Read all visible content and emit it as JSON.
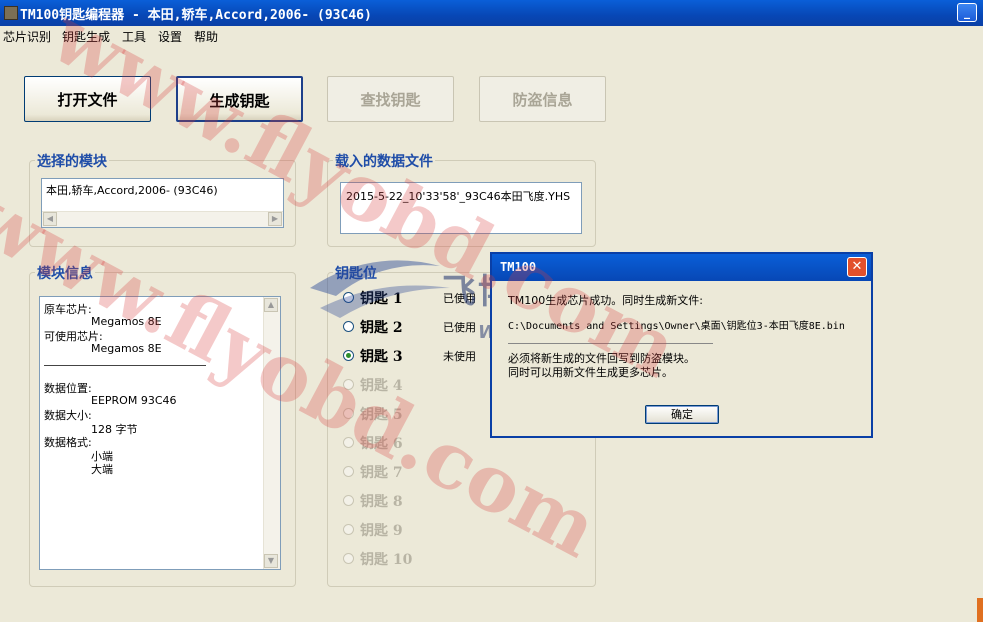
{
  "window": {
    "title": "TM100钥匙编程器 - 本田,轿车,Accord,2006- (93C46)",
    "minimize": "_"
  },
  "menu": [
    "芯片识别",
    "钥匙生成",
    "工具",
    "设置",
    "帮助"
  ],
  "toolbar": {
    "open_file": "打开文件",
    "generate_key": "生成钥匙",
    "find_key": "查找钥匙",
    "anti_theft_info": "防盗信息"
  },
  "selected_module": {
    "title": "选择的模块",
    "value": "本田,轿车,Accord,2006- (93C46)"
  },
  "loaded_file": {
    "title": "载入的数据文件",
    "value": "2015-5-22_10'33'58'_93C46本田飞度.YHS"
  },
  "module_info": {
    "title": "模块信息",
    "lines": [
      {
        "text": "原车芯片:",
        "indent": false
      },
      {
        "text": "Megamos 8E",
        "indent": true
      },
      {
        "text": "可使用芯片:",
        "indent": false
      },
      {
        "text": "Megamos 8E",
        "indent": true
      },
      {
        "text": "数据位置:",
        "indent": false
      },
      {
        "text": "EEPROM 93C46",
        "indent": true
      },
      {
        "text": "数据大小:",
        "indent": false
      },
      {
        "text": "128 字节",
        "indent": true
      },
      {
        "text": "数据格式:",
        "indent": false
      },
      {
        "text": "小端",
        "indent": true
      },
      {
        "text": "大端",
        "indent": true
      }
    ]
  },
  "key_positions": {
    "title": "钥匙位",
    "items": [
      {
        "label": "钥匙 1",
        "status": "已使用",
        "enabled": true,
        "selected": false
      },
      {
        "label": "钥匙 2",
        "status": "已使用",
        "enabled": true,
        "selected": false
      },
      {
        "label": "钥匙 3",
        "status": "未使用",
        "enabled": true,
        "selected": true
      },
      {
        "label": "钥匙 4",
        "status": "",
        "enabled": false,
        "selected": false
      },
      {
        "label": "钥匙 5",
        "status": "",
        "enabled": false,
        "selected": false
      },
      {
        "label": "钥匙 6",
        "status": "",
        "enabled": false,
        "selected": false
      },
      {
        "label": "钥匙 7",
        "status": "",
        "enabled": false,
        "selected": false
      },
      {
        "label": "钥匙 8",
        "status": "",
        "enabled": false,
        "selected": false
      },
      {
        "label": "钥匙 9",
        "status": "",
        "enabled": false,
        "selected": false
      },
      {
        "label": "钥匙 10",
        "status": "",
        "enabled": false,
        "selected": false
      }
    ]
  },
  "dialog": {
    "title": "TM100",
    "line1": "TM100生成芯片成功。同时生成新文件:",
    "path": "C:\\Documents and Settings\\Owner\\桌面\\钥匙位3-本田飞度8E.bin",
    "line3": "必须将新生成的文件回写到防盗模块。",
    "line4": "同时可以用新文件生成更多芯片。",
    "ok": "确定",
    "close": "✕"
  },
  "watermark": {
    "text": "www.flyobd.com",
    "logo_text": "飞博汽车电子",
    "logo_url": "Www.Feite.Cn"
  }
}
